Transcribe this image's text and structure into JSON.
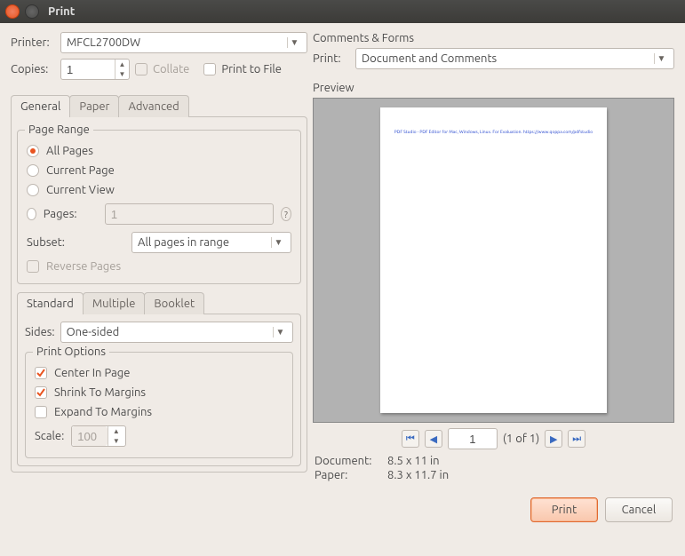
{
  "window": {
    "title": "Print"
  },
  "printer": {
    "label": "Printer:",
    "value": "MFCL2700DW"
  },
  "copies": {
    "label": "Copies:",
    "value": "1",
    "collate_label": "Collate",
    "tofile_label": "Print to File"
  },
  "tabs_top": {
    "general": "General",
    "paper": "Paper",
    "advanced": "Advanced"
  },
  "range": {
    "legend": "Page Range",
    "all": "All Pages",
    "current_page": "Current Page",
    "current_view": "Current View",
    "pages_lbl": "Pages:",
    "pages_val": "1",
    "subset_lbl": "Subset:",
    "subset_val": "All pages in range",
    "reverse": "Reverse Pages"
  },
  "tabs_mid": {
    "standard": "Standard",
    "multiple": "Multiple",
    "booklet": "Booklet"
  },
  "sides": {
    "label": "Sides:",
    "value": "One-sided"
  },
  "options": {
    "legend": "Print Options",
    "center": "Center In Page",
    "shrink": "Shrink To Margins",
    "expand": "Expand To Margins",
    "scale_lbl": "Scale:",
    "scale_val": "100"
  },
  "comments": {
    "header": "Comments & Forms",
    "print_lbl": "Print:",
    "value": "Document and Comments"
  },
  "preview": {
    "header": "Preview",
    "watermark": "PDF Studio - PDF Editor for Mac, Windows, Linux. For Evaluation. https://www.qoppa.com/pdfstudio",
    "page_value": "1",
    "page_of": "(1 of 1)",
    "doc_lbl": "Document:",
    "doc_val": "8.5 x 11 in",
    "paper_lbl": "Paper:",
    "paper_val": "8.3 x 11.7 in"
  },
  "footer": {
    "print": "Print",
    "cancel": "Cancel"
  }
}
